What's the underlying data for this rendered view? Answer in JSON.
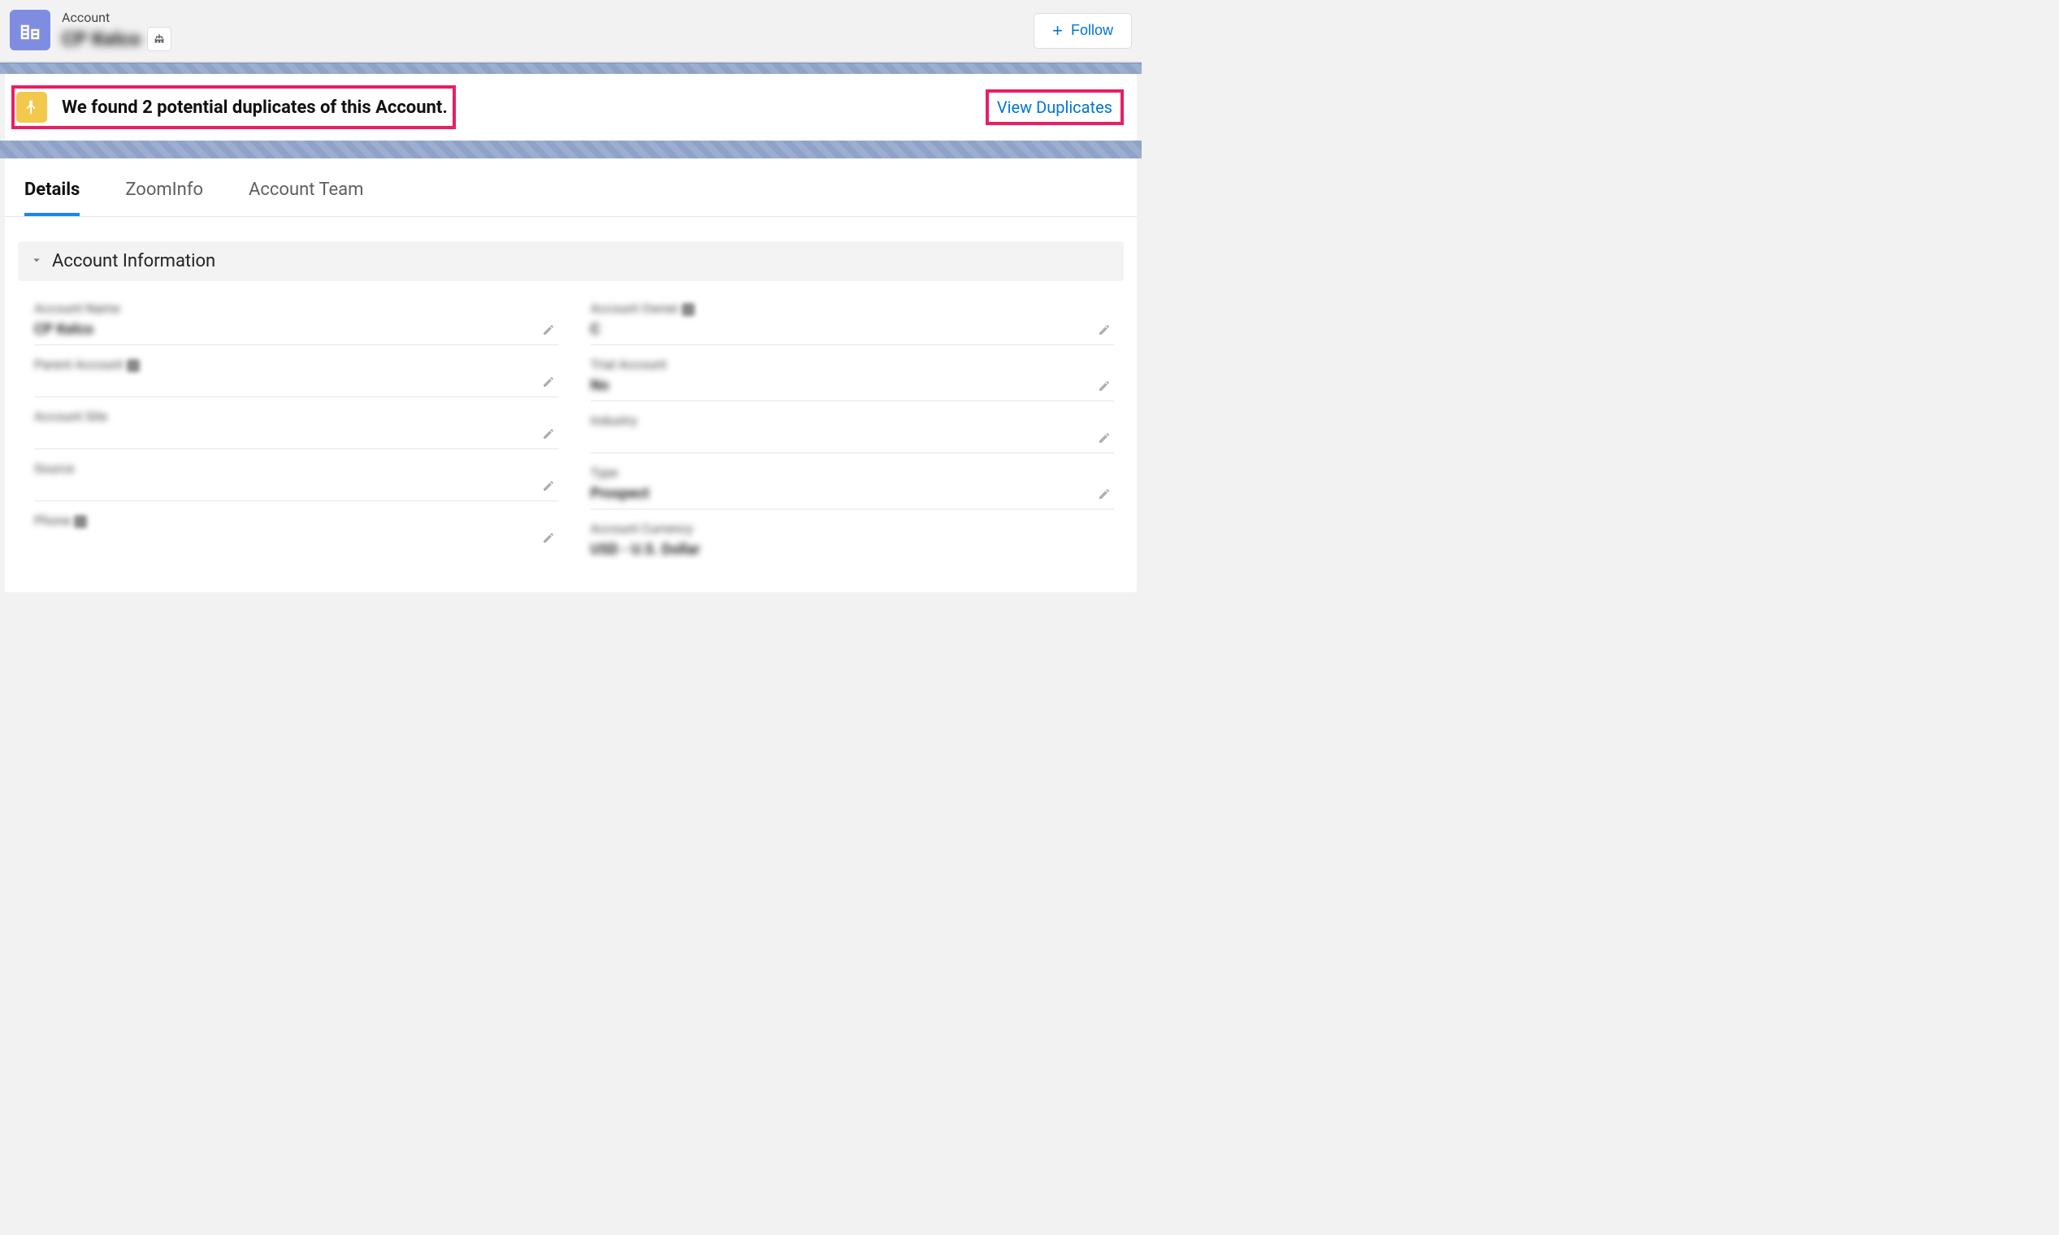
{
  "header": {
    "object_type": "Account",
    "object_name": "CP Kelco",
    "follow_label": "Follow"
  },
  "duplicate_banner": {
    "message": "We found 2 potential duplicates of this Account.",
    "link_label": "View Duplicates"
  },
  "tabs": [
    {
      "label": "Details",
      "active": true
    },
    {
      "label": "ZoomInfo",
      "active": false
    },
    {
      "label": "Account Team",
      "active": false
    }
  ],
  "section": {
    "title": "Account Information"
  },
  "fields_left": [
    {
      "label": "Account Name",
      "value": "CP Kelco"
    },
    {
      "label": "Parent Account",
      "value": ""
    },
    {
      "label": "Account Site",
      "value": ""
    },
    {
      "label": "Source",
      "value": ""
    },
    {
      "label": "Phone",
      "value": ""
    }
  ],
  "fields_right": [
    {
      "label": "Account Owner",
      "value": "C"
    },
    {
      "label": "Trial Account",
      "value": "No"
    },
    {
      "label": "Industry",
      "value": ""
    },
    {
      "label": "Type",
      "value": "Prospect"
    },
    {
      "label": "Account Currency",
      "value": "USD - U.S. Dollar"
    }
  ]
}
